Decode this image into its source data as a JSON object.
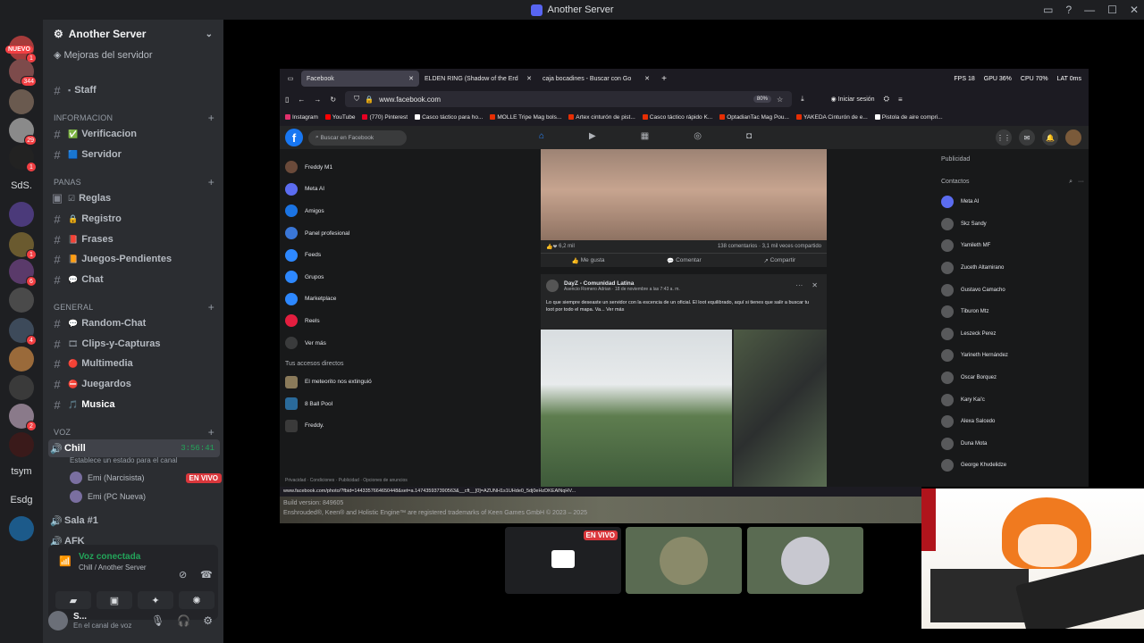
{
  "window": {
    "title": "Another Server",
    "controls": [
      "▭",
      "?",
      "—",
      "☐",
      "✕"
    ]
  },
  "servers": {
    "nuevo_label": "NUEVO",
    "items": [
      {
        "label": "",
        "badge": "1"
      },
      {
        "label": "",
        "badge": "344"
      },
      {
        "label": "",
        "badge": ""
      },
      {
        "label": "",
        "badge": "29"
      },
      {
        "label": "",
        "badge": "1"
      },
      {
        "label": "SdS.",
        "badge": ""
      },
      {
        "label": "",
        "badge": ""
      },
      {
        "label": "",
        "badge": "1"
      },
      {
        "label": "",
        "badge": "6"
      },
      {
        "label": "",
        "badge": ""
      },
      {
        "label": "",
        "badge": "4"
      },
      {
        "label": "",
        "badge": ""
      },
      {
        "label": "",
        "badge": ""
      },
      {
        "label": "",
        "badge": "2"
      },
      {
        "label": "",
        "badge": ""
      },
      {
        "label": "tsym",
        "badge": ""
      },
      {
        "label": "Esdg",
        "badge": ""
      },
      {
        "label": "",
        "badge": ""
      }
    ]
  },
  "server": {
    "name": "Another Server",
    "boost_label": "Mejoras del servidor",
    "staff": {
      "name": "Staff"
    },
    "categories": {
      "informacion": "INFORMACION",
      "panas": "PANAS",
      "general": "GENERAL",
      "voz": "VOZ"
    },
    "info_channels": [
      {
        "emoji": "✅",
        "name": "Verificacion"
      },
      {
        "emoji": "🟦",
        "name": "Servidor"
      }
    ],
    "panas_channels": [
      {
        "emoji": "☑",
        "name": "Reglas"
      },
      {
        "emoji": "🔒",
        "name": "Registro"
      },
      {
        "emoji": "📕",
        "name": "Frases"
      },
      {
        "emoji": "📙",
        "name": "Juegos-Pendientes"
      },
      {
        "emoji": "💬",
        "name": "Chat"
      }
    ],
    "general_channels": [
      {
        "emoji": "💬",
        "name": "Random-Chat"
      },
      {
        "emoji": "🎞",
        "name": "Clips-y-Capturas"
      },
      {
        "emoji": "🔴",
        "name": "Multimedia"
      },
      {
        "emoji": "⛔",
        "name": "Juegardos"
      },
      {
        "emoji": "🎵",
        "name": "Musica"
      }
    ],
    "voice": {
      "chill": {
        "name": "Chill",
        "time": "3:56:41",
        "status": "Establece un estado para el canal"
      },
      "users": [
        {
          "name": "Emi (Narcisista)",
          "live": "EN VIVO"
        },
        {
          "name": "Emi (PC Nueva)",
          "live": ""
        }
      ],
      "sala1": "Sala #1",
      "afk": "AFK"
    }
  },
  "voicebar": {
    "title": "Voz conectada",
    "sub": "Chill / Another Server"
  },
  "user": {
    "name": "S...",
    "status": "En el canal de voz"
  },
  "browser": {
    "tabs": [
      {
        "title": "Facebook"
      },
      {
        "title": "ELDEN RING (Shadow of the Erd"
      },
      {
        "title": "caja bocadines - Buscar con Go"
      }
    ],
    "stats": [
      "FPS 18",
      "GPU 36%",
      "CPU 70%",
      "LAT 0ms"
    ],
    "url": "www.facebook.com",
    "zoom": "80%",
    "login": "Iniciar sesión",
    "bookmarks": [
      "Instagram",
      "YouTube",
      "(770) Pinterest",
      "Casco táctico para ho...",
      "MOLLE Tripe Mag bols...",
      "Artex cinturón de pist...",
      "Casco táctico rápido K...",
      "OptadianTac Mag Pou...",
      "YAKEDA Cinturón de e...",
      "Pistola de aire compri..."
    ],
    "status_url": "www.facebook.com/photo/?fbid=1443357664650448&set=a.147435937390563&__cft__[0]=AZUNH1s1UHde0_5dj0eHzDKEAlNqHV..."
  },
  "facebook": {
    "search_placeholder": "Buscar en Facebook",
    "menu": [
      "Freddy M1",
      "Meta AI",
      "Amigos",
      "Panel profesional",
      "Feeds",
      "Grupos",
      "Marketplace",
      "Reels",
      "Ver más"
    ],
    "shortcuts_title": "Tus accesos directos",
    "shortcuts": [
      "El meteorito nos extinguió",
      "8 Ball Pool",
      "Freddy."
    ],
    "footer": "Privacidad · Condiciones · Publicidad · Opciones de anuncios",
    "post1": {
      "reactions": "6,2 mil",
      "stats": "138 comentarios · 3,1 mil veces compartido",
      "like": "Me gusta",
      "comment": "Comentar",
      "share": "Compartir"
    },
    "post2": {
      "group": "DayZ - Comunidad Latina",
      "author": "Asencio Romero Adrian · 18 de noviembre a las 7:43 a. m.",
      "text": "Lo que siempre deseaste un servidor con la escencia de un oficial. El loot equilibrado, aquí si tienes que salir a buscar tu loot por todo el mapa. Va... Ver más"
    },
    "right_title": "Publicidad",
    "contacts_title": "Contactos",
    "contacts": [
      "Meta AI",
      "Skz Sandy",
      "Yamileth MF",
      "Zuceth Altamirano",
      "Gustavo Camacho",
      "Tiburon Mtz",
      "Leszeck Perez",
      "Yarineth Hernández",
      "Oscar Borquez",
      "Kary Kai'c",
      "Alexa Salcedo",
      "Duna Mota",
      "George Khvdelidze"
    ]
  },
  "game_overlay": {
    "build": "Build version: 849605",
    "trademark": "Enshrouded®, Keen® and Holistic Engine™ are registered trademarks of Keen Games GmbH © 2023 – 2025"
  },
  "stream_tiles": {
    "live": "EN VIVO"
  }
}
